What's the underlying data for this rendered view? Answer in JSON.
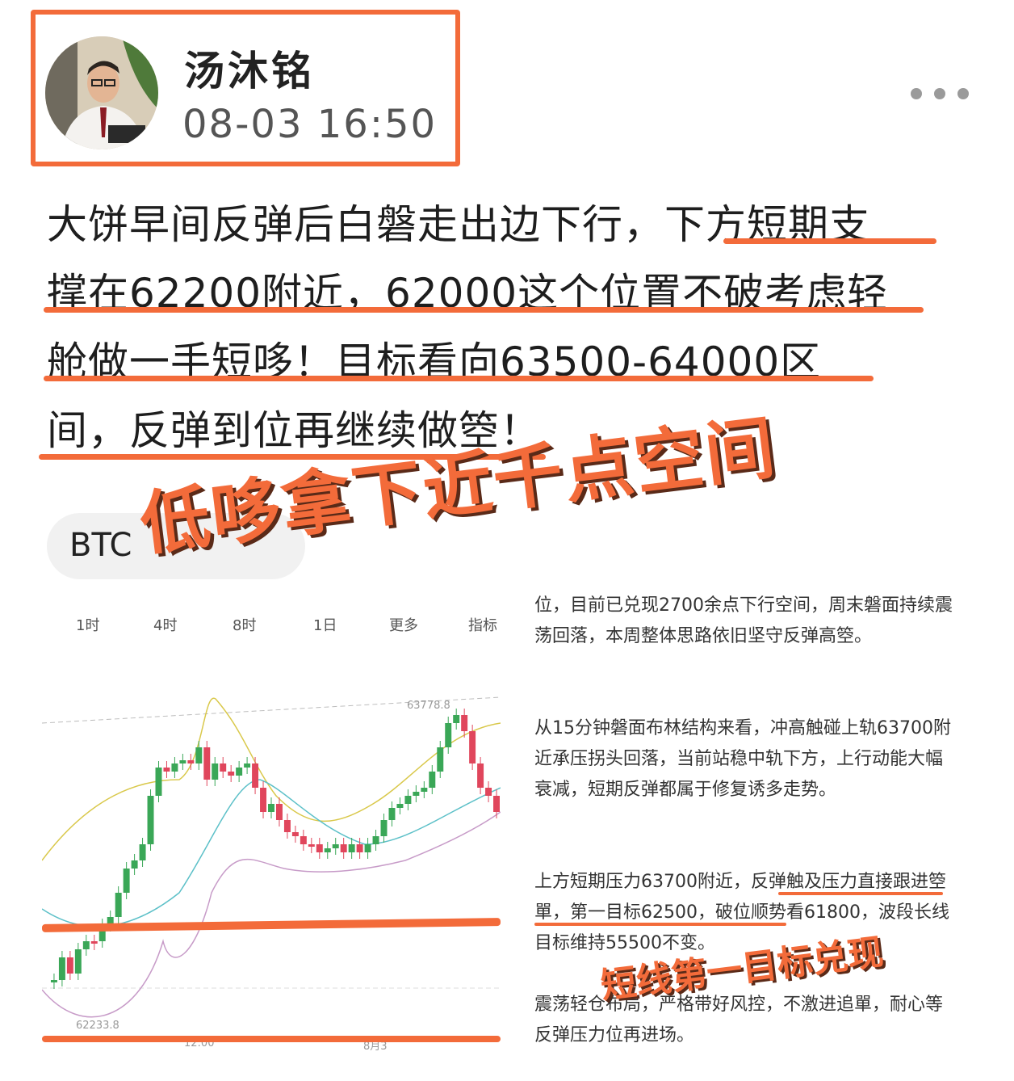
{
  "author": {
    "name": "汤沐铭",
    "timestamp": "08-03 16:50"
  },
  "post": {
    "lines": [
      "大饼早间反弹后白磐走出边下行，下方短期支",
      "撑在62200附近，62000这个位置不破考虑轻",
      "舱做一手短哆！目标看向63500-64000区",
      "间，反弹到位再继续做箜！"
    ]
  },
  "ticker": {
    "label": "BTC"
  },
  "headline": "低哆拿下近千点空间",
  "chart": {
    "timeframes": [
      "1时",
      "4时",
      "8时",
      "1日",
      "更多",
      "指标"
    ],
    "high_label": "63778.8",
    "low_label": "62233.8",
    "x_labels": [
      "12:00",
      "8月3"
    ]
  },
  "analysis": {
    "paragraphs": [
      "位，目前已兑现2700余点下行空间，周末磐面持续震荡回落，本周整体思路依旧坚守反弹高箜。",
      "从15分钟磐面布林结构来看，冲高触碰上轨63700附近承压拐头回落，当前站稳中轨下方，上行动能大幅衰减，短期反弹都属于修复诱多走势。",
      "上方短期压力63700附近，反弹触及压力直接跟进箜單，第一目标62500，破位顺势看61800，波段长线目标维持55500不变。",
      "震荡轻仓布局，严格带好风控，不激进追單，耐心等反弹压力位再进场。"
    ]
  },
  "stamp": "短线第一目标兑现",
  "colors": {
    "accent": "#f36b3a",
    "up": "#3aa757",
    "down": "#e0465c"
  }
}
